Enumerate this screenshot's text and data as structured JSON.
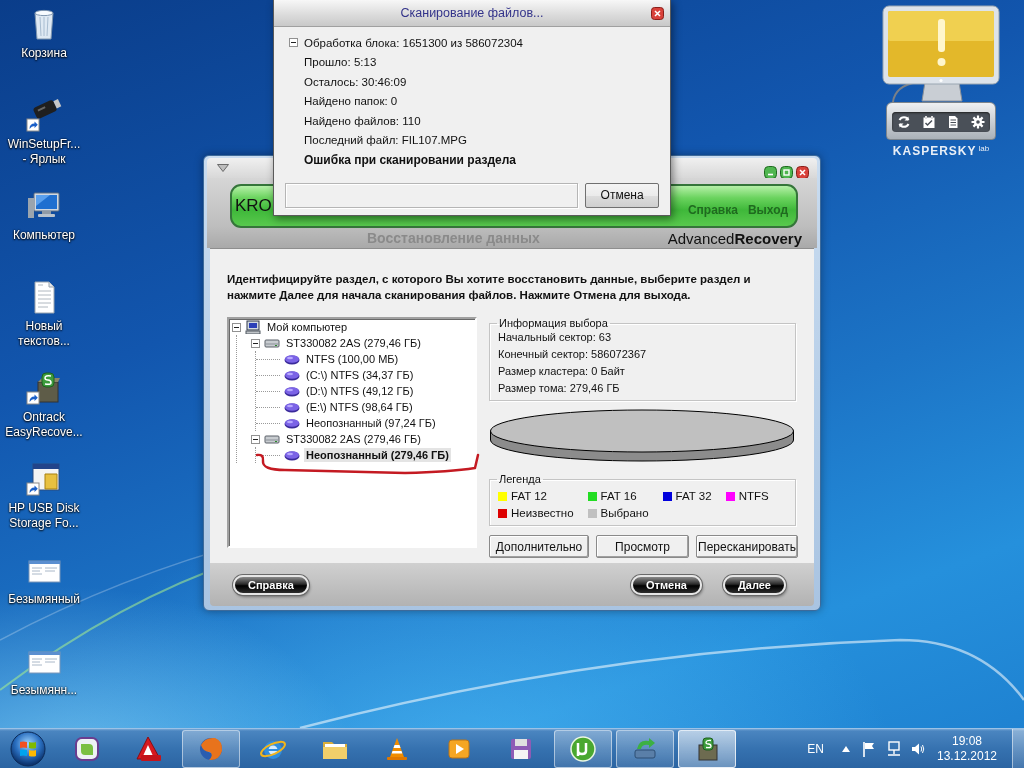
{
  "desktop": {
    "icons": [
      {
        "kind": "recycle",
        "shortcut": false,
        "lines": [
          "Корзина"
        ]
      },
      {
        "kind": "usb",
        "shortcut": true,
        "lines": [
          "WinSetupFr...",
          "- Ярлык"
        ]
      },
      {
        "kind": "computer",
        "shortcut": false,
        "lines": [
          "Компьютер"
        ]
      },
      {
        "kind": "document",
        "shortcut": false,
        "lines": [
          "Новый",
          "текстов..."
        ]
      },
      {
        "kind": "box",
        "shortcut": true,
        "lines": [
          "Ontrack",
          "EasyRecove..."
        ]
      },
      {
        "kind": "window",
        "shortcut": true,
        "lines": [
          "HP USB Disk",
          "Storage Fo..."
        ]
      },
      {
        "kind": "thumbnail",
        "shortcut": false,
        "lines": [
          "Безымянный"
        ]
      },
      {
        "kind": "thumbnail",
        "shortcut": false,
        "lines": [
          "Безымянн..."
        ]
      }
    ]
  },
  "scan_dialog": {
    "title": "Сканирование файлов...",
    "group": {
      "label": "Обработка блока: 1651300 из 586072304",
      "expanded": true,
      "lines": [
        "Прошло: 5:13",
        "Осталось: 30:46:09",
        "Найдено папок: 0",
        "Найдено файлов: 110",
        "Последний файл: FIL107.MPG"
      ]
    },
    "error": "Ошибка при сканировании раздела",
    "progress": {
      "level": 0
    },
    "cancel_button": "Отмена"
  },
  "gadget": {
    "logo": "KASPERSKY",
    "logo_suffix": "lab"
  },
  "main_window": {
    "banner": {
      "brand": "KRO",
      "links": [
        "Справка",
        "Выход"
      ]
    },
    "section_title": "Восстановление данных",
    "product": "Advanced**Recovery**",
    "instruction": "Идентифицируйте раздел, с которого Вы хотите восстановить данные, выберите раздел и нажмите Далее для начала сканирования файлов. Нажмите Отмена для выхода.",
    "tree": [
      {
        "label": "Мой компьютер",
        "kind": "computer",
        "expanded": true,
        "selected": false,
        "children": [
          {
            "label": "ST330082 2AS (279,46 ГБ)",
            "kind": "disk",
            "expanded": true,
            "selected": false,
            "children": [
              {
                "label": "NTFS (100,00 МБ)",
                "kind": "partition",
                "selected": false
              },
              {
                "label": "(C:\\) NTFS (34,37 ГБ)",
                "kind": "partition",
                "selected": false
              },
              {
                "label": "(D:\\) NTFS (49,12 ГБ)",
                "kind": "partition",
                "selected": false
              },
              {
                "label": "(E:\\) NTFS (98,64 ГБ)",
                "kind": "partition",
                "selected": false
              },
              {
                "label": "Неопознанный (97,24 ГБ)",
                "kind": "partition",
                "selected": false
              }
            ]
          },
          {
            "label": "ST330082 2AS (279,46 ГБ)",
            "kind": "disk",
            "expanded": true,
            "selected": false,
            "children": [
              {
                "label": "Неопознанный (279,46 ГБ)",
                "kind": "partition",
                "selected": true
              }
            ]
          }
        ]
      }
    ],
    "selection_info": {
      "title": "Информация выбора",
      "lines": [
        "Начальный сектор: 63",
        "Конечный сектор: 586072367",
        "Размер кластера: 0 Байт",
        "Размер тома: 279,46 ГБ"
      ]
    },
    "legend": {
      "title": "Легенда",
      "items": [
        {
          "label": "FAT 12",
          "color": "#ffff00"
        },
        {
          "label": "FAT 16",
          "color": "#22dd22"
        },
        {
          "label": "FAT 32",
          "color": "#0000dd"
        },
        {
          "label": "NTFS",
          "color": "#ff00ff"
        },
        {
          "label": "Неизвестно",
          "color": "#dd0000"
        },
        {
          "label": "Выбрано",
          "color": "#c0c0c0"
        }
      ]
    },
    "actions": [
      "Дополнительно",
      "Просмотр",
      "Пересканировать"
    ],
    "footer": {
      "left": [
        "Справка"
      ],
      "right": [
        "Отмена",
        "Далее"
      ]
    }
  },
  "taskbar": {
    "apps": [
      {
        "kind": "square",
        "running": false,
        "selected": false
      },
      {
        "kind": "triangle",
        "running": false,
        "selected": false
      },
      {
        "kind": "globe",
        "running": true,
        "selected": false
      },
      {
        "kind": "orbit",
        "running": false,
        "selected": false
      },
      {
        "kind": "folder",
        "running": false,
        "selected": false
      },
      {
        "kind": "cone",
        "running": false,
        "selected": false
      },
      {
        "kind": "player",
        "running": false,
        "selected": false
      },
      {
        "kind": "floppy",
        "running": false,
        "selected": false
      },
      {
        "kind": "torrent",
        "running": true,
        "selected": false
      },
      {
        "kind": "scanner",
        "running": true,
        "selected": false
      },
      {
        "kind": "safe",
        "running": true,
        "selected": true
      }
    ],
    "tray": {
      "language": "EN",
      "time": "19:08",
      "date": "13.12.2012"
    }
  }
}
